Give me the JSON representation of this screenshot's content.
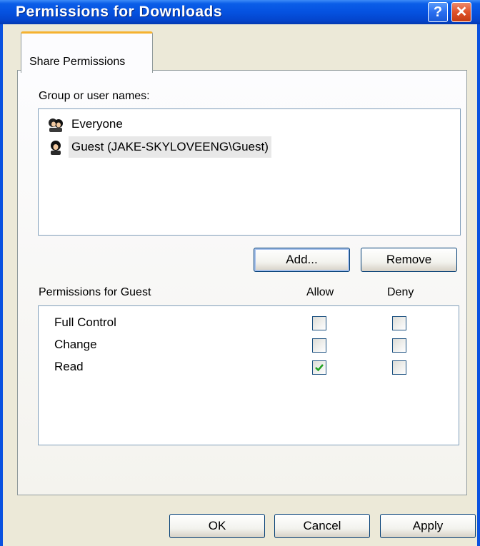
{
  "window": {
    "title": "Permissions for Downloads",
    "help_glyph": "?",
    "close_glyph": "✕"
  },
  "tab": {
    "label": "Share Permissions"
  },
  "users": {
    "label": "Group or user names:",
    "items": [
      {
        "name": "Everyone",
        "icon": "group-users-icon",
        "selected": false
      },
      {
        "name": "Guest (JAKE-SKYLOVEENG\\Guest)",
        "icon": "user-icon",
        "selected": true
      }
    ]
  },
  "buttons": {
    "add": "Add...",
    "remove": "Remove",
    "ok": "OK",
    "cancel": "Cancel",
    "apply": "Apply"
  },
  "permissions": {
    "label": "Permissions for Guest",
    "allow_header": "Allow",
    "deny_header": "Deny",
    "rows": [
      {
        "name": "Full Control",
        "allow": false,
        "deny": false
      },
      {
        "name": "Change",
        "allow": false,
        "deny": false
      },
      {
        "name": "Read",
        "allow": true,
        "deny": false
      }
    ]
  },
  "colors": {
    "titlebar": "#0552e0",
    "tab_accent": "#f5b230",
    "check": "#21a121",
    "selection": "#e8e8e8"
  }
}
